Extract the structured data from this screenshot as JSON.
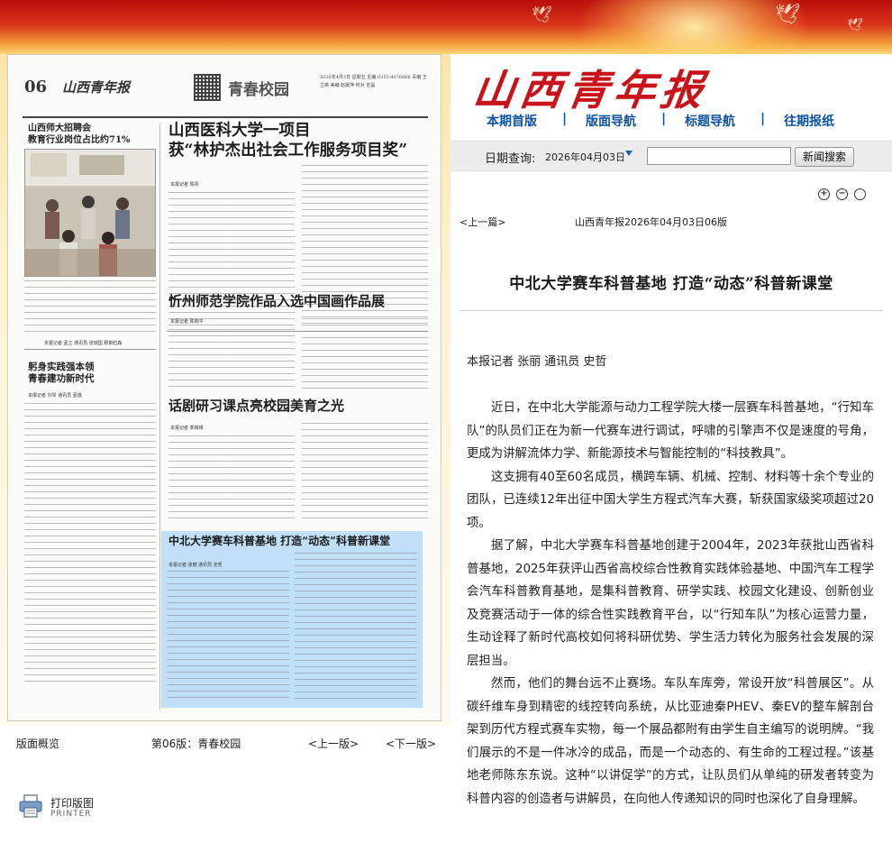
{
  "site": {
    "logo_text": "山西青年报",
    "brand_color": "#c8131a",
    "nav": [
      {
        "label": "本期首版"
      },
      {
        "label": "版面导航"
      },
      {
        "label": "标题导航"
      },
      {
        "label": "往期报纸"
      }
    ],
    "nav_separator": "|"
  },
  "date_search": {
    "label": "日期查询:",
    "date": "2026年04月03日",
    "search_placeholder": "",
    "search_button": "新闻搜索"
  },
  "zoom_controls": {
    "zoom_in": "+",
    "zoom_out": "−",
    "reset": ""
  },
  "article_nav": {
    "prev": "<上一篇>",
    "info": "山西青年报2026年04月03日06版"
  },
  "article": {
    "title": "中北大学赛车科普基地 打造“动态”科普新课堂",
    "byline": "本报记者 张丽  通讯员 史哲",
    "paragraphs": [
      "近日，在中北大学能源与动力工程学院大楼一层赛车科普基地，“行知车队”的队员们正在为新一代赛车进行调试，呼啸的引擎声不仅是速度的号角，更成为讲解流体力学、新能源技术与智能控制的“科技教具”。",
      "这支拥有40至60名成员，横跨车辆、机械、控制、材料等十余个专业的团队，已连续12年出征中国大学生方程式汽车大赛，斩获国家级奖项超过20项。",
      "据了解，中北大学赛车科普基地创建于2004年，2023年获批山西省科普基地，2025年获评山西省高校综合性教育实践体验基地、中国汽车工程学会汽车科普教育基地，是集科普教育、研学实践、校园文化建设、创新创业及竞赛活动于一体的综合性实践教育平台，以“行知车队”为核心运营力量，生动诠释了新时代高校如何将科研优势、学生活力转化为服务社会发展的深层担当。",
      "然而，他们的舞台远不止赛场。车队车库旁，常设开放“科普展区”。从碳纤维车身到精密的线控转向系统，从比亚迪秦PHEV、秦EV的整车解剖台架到历代方程式赛车实物，每一个展品都附有由学生自主编写的说明牌。“我们展示的不是一件冰冷的成品，而是一个动态的、有生命的工程过程。”该基地老师陈东东说。这种“以讲促学”的方式，让队员们从单纯的研发者转变为科普内容的创造者与讲解员，在向他人传递知识的同时也深化了自身理解。"
    ]
  },
  "paper_page": {
    "page_no": "06",
    "mini_logo": "山西青年报",
    "section": "青春校园",
    "dateline": "2026年4月3日 星期五 主编:0351-4076666 责编 王立英 美编 赵媛萍 校对 史磊",
    "headlines": {
      "a1": "山西师大招聘会\n教育行业岗位占比约71%",
      "a2": "山西医科大学一项目\n获“林护杰出社会工作服务项目奖”",
      "a3": "躬身实践强本领\n青春建功新时代",
      "a4": "忻州师范学院作品入选中国画作品展",
      "a5": "话剧研习课点亮校园美育之光",
      "a6": "中北大学赛车科普基地  打造“动态”科普新课堂"
    },
    "bylines": {
      "a2": "本报记者 陈彤",
      "a3": "本报记者 刘琴 通讯员 孟莲",
      "a4": "本报记者 陈晓平",
      "a5": "本报记者 郭晴晴",
      "a6": "本报记者 张丽 通讯员 史哲",
      "a1_photo": "本报记者 孟立 通讯员 张瑞国 穆斯粒森"
    }
  },
  "paper_nav": {
    "overview": "版面概览",
    "current": "第06版：青春校园",
    "prev": "<上一版>",
    "next": "<下一版>"
  },
  "printer": {
    "label": "打印版图",
    "sub": "PRINTER"
  }
}
